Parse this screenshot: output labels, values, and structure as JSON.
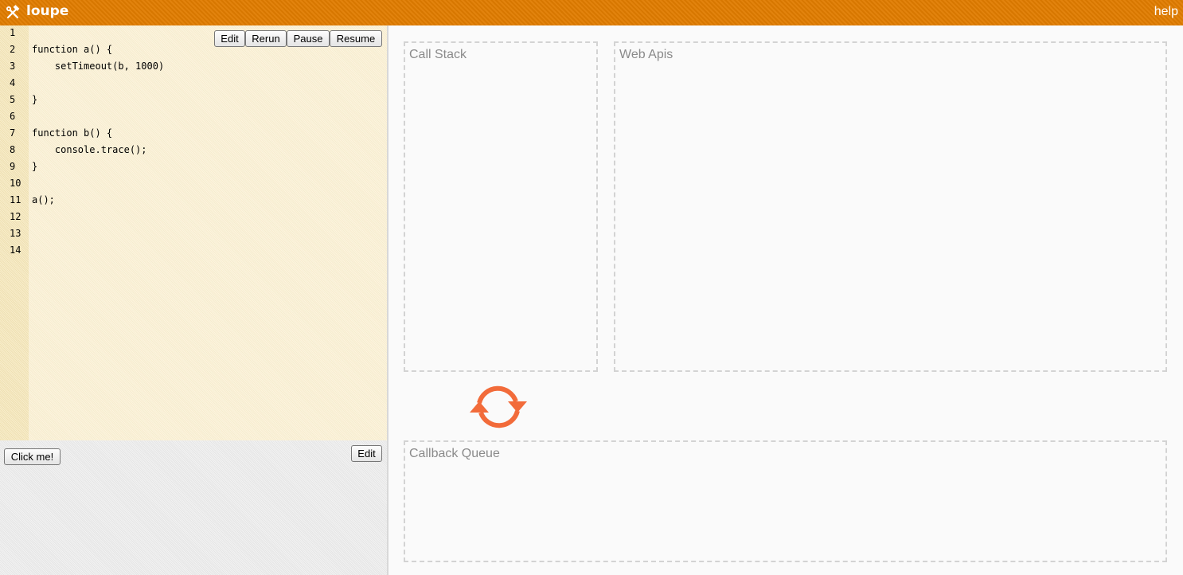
{
  "app": {
    "title": "loupe",
    "help_label": "help",
    "logo_icon": "hammer-wrench-icon"
  },
  "editor": {
    "lines": [
      {
        "num": "1",
        "code": ""
      },
      {
        "num": "2",
        "code": "function a() {"
      },
      {
        "num": "3",
        "code": "    setTimeout(b, 1000)"
      },
      {
        "num": "4",
        "code": ""
      },
      {
        "num": "5",
        "code": "}"
      },
      {
        "num": "6",
        "code": ""
      },
      {
        "num": "7",
        "code": "function b() {"
      },
      {
        "num": "8",
        "code": "    console.trace();"
      },
      {
        "num": "9",
        "code": "}"
      },
      {
        "num": "10",
        "code": ""
      },
      {
        "num": "11",
        "code": "a();"
      },
      {
        "num": "12",
        "code": ""
      },
      {
        "num": "13",
        "code": ""
      },
      {
        "num": "14",
        "code": ""
      }
    ],
    "buttons": {
      "edit": "Edit",
      "rerun": "Rerun",
      "pause": "Pause",
      "resume": "Resume"
    }
  },
  "html_panel": {
    "click_button": "Click me!",
    "edit_button": "Edit"
  },
  "visualizer": {
    "call_stack": "Call Stack",
    "web_apis": "Web Apis",
    "callback_queue": "Callback Queue",
    "event_loop_icon": "event-loop-icon",
    "accent_color": "#f26b3a"
  },
  "colors": {
    "topbar": "#e07c00",
    "editor_bg": "#fbf1d3",
    "gutter_bg": "#f6e7b9",
    "panel_border": "#d3d3d3"
  }
}
